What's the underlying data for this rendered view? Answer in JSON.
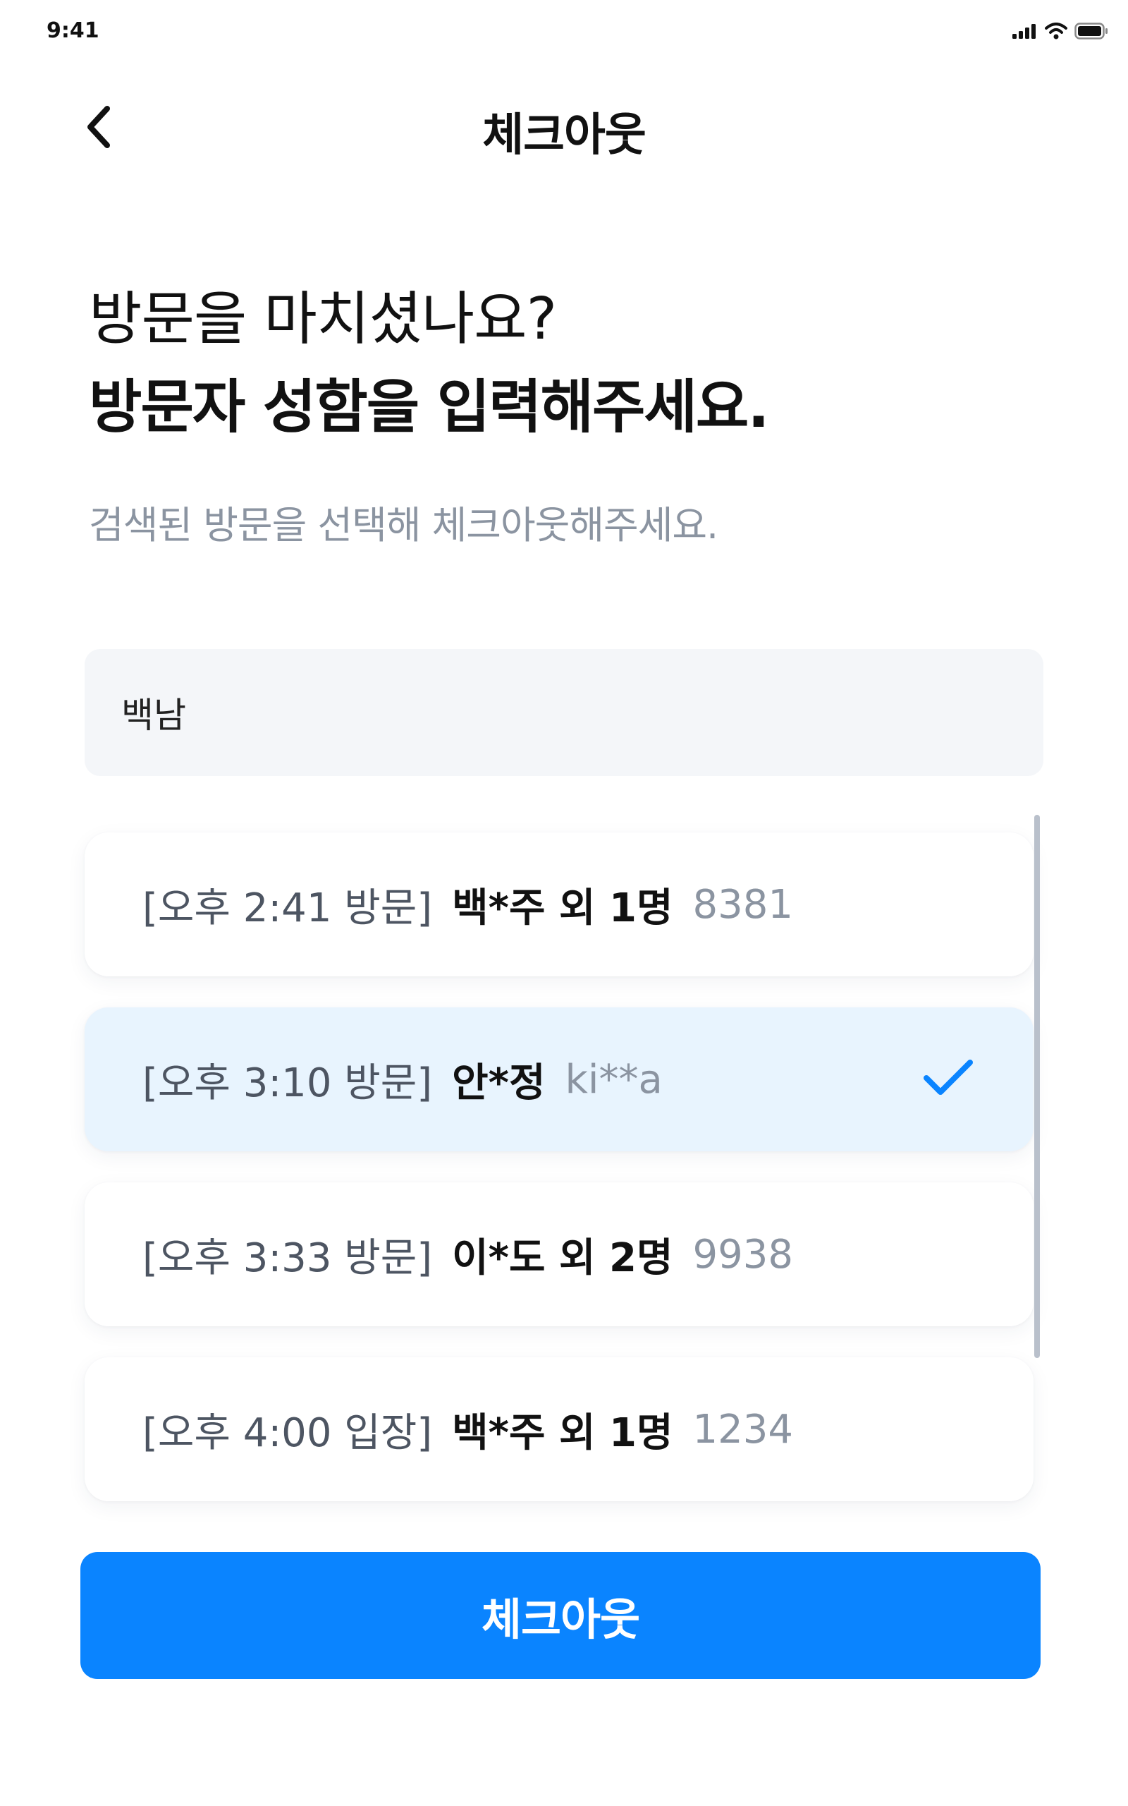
{
  "status_bar": {
    "time": "9:41"
  },
  "header": {
    "title": "체크아웃"
  },
  "content": {
    "question": "방문을 마치셨나요?",
    "instruction": "방문자 성함을 입력해주세요.",
    "hint": "검색된 방문을 선택해 체크아웃해주세요."
  },
  "search": {
    "value": "백남"
  },
  "results": [
    {
      "time": "[오후 2:41 방문]",
      "name": "백*주 외 1명",
      "code": "8381",
      "selected": false
    },
    {
      "time": "[오후 3:10 방문]",
      "name": "안*정",
      "code": "ki**a",
      "selected": true
    },
    {
      "time": "[오후 3:33 방문]",
      "name": "이*도 외 2명",
      "code": "9938",
      "selected": false
    },
    {
      "time": "[오후 4:00 입장]",
      "name": "백*주 외 1명",
      "code": "1234",
      "selected": false
    }
  ],
  "actions": {
    "checkout_label": "체크아웃"
  },
  "colors": {
    "accent": "#0a84ff",
    "selected_bg": "#e8f4fe",
    "muted_text": "#8b94a1"
  }
}
